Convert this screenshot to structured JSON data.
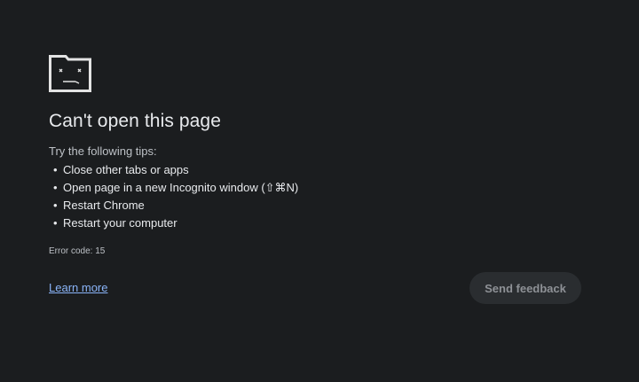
{
  "title": "Can't open this page",
  "tips_heading": "Try the following tips:",
  "tips": [
    "Close other tabs or apps",
    "Open page in a new Incognito window (⇧⌘N)",
    "Restart Chrome",
    "Restart your computer"
  ],
  "error_code": "Error code: 15",
  "learn_more_label": "Learn more",
  "send_feedback_label": "Send feedback",
  "icon": "sad-folder-icon",
  "colors": {
    "background": "#1b1d1f",
    "link": "#8ab4f8",
    "button_bg": "#2a2d30"
  }
}
